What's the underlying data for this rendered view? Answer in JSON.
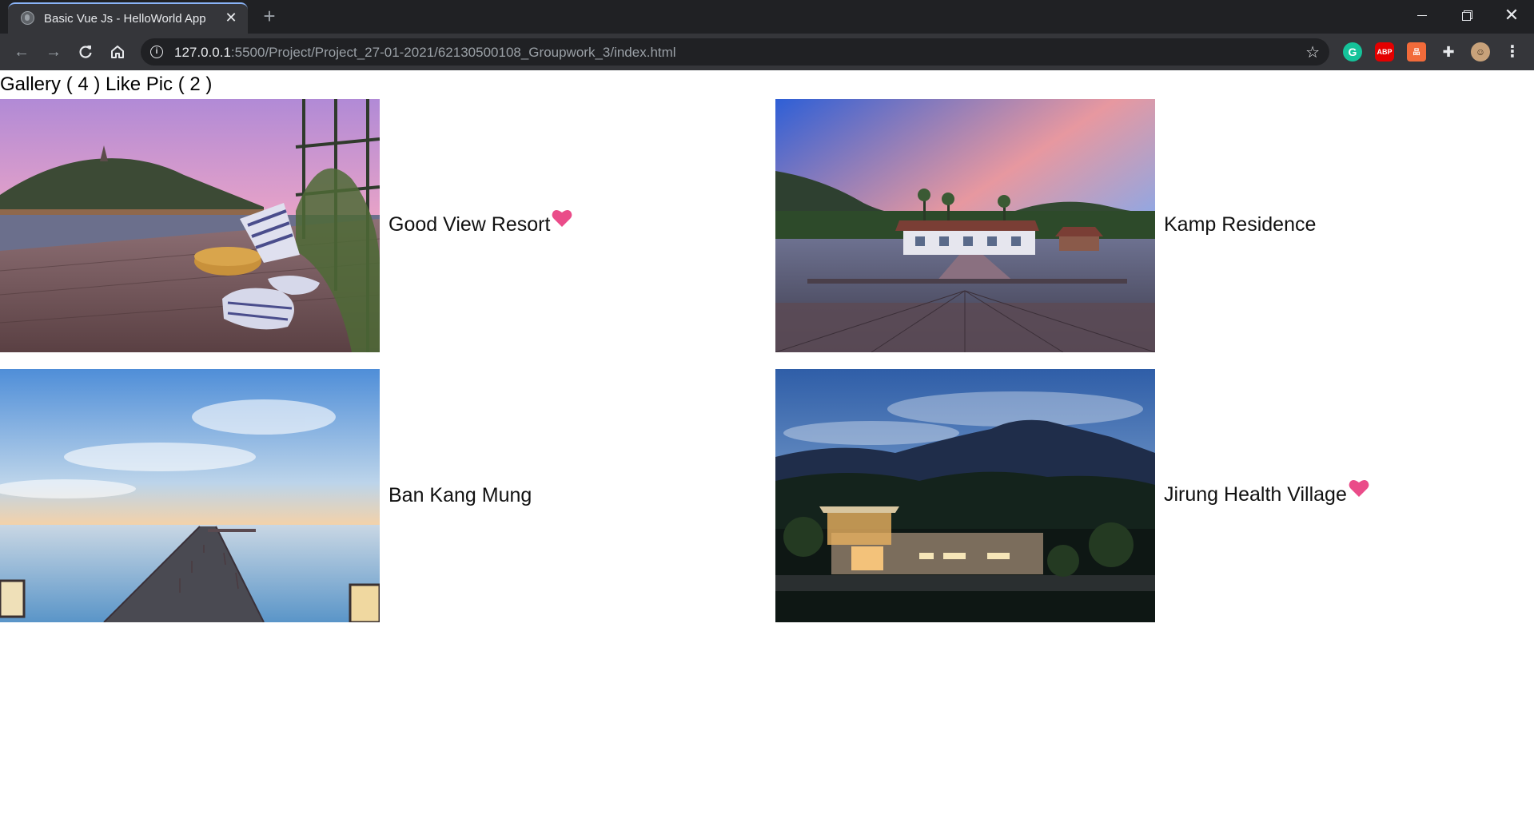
{
  "browser": {
    "tab_title": "Basic Vue Js - HelloWorld App",
    "tab_close": "✕",
    "new_tab": "+",
    "url_host": "127.0.0.1",
    "url_path": ":5500/Project/Project_27-01-2021/62130500108_Groupwork_3/index.html"
  },
  "page": {
    "gallery_label": "Gallery ( 4 ) Like Pic ( 2 )"
  },
  "gallery": [
    {
      "name": "Good View Resort",
      "liked": true
    },
    {
      "name": "Kamp Residence",
      "liked": false
    },
    {
      "name": "Ban Kang Mung",
      "liked": false
    },
    {
      "name": "Jirung Health Village",
      "liked": true
    }
  ],
  "colors": {
    "heart": "#ea4c89",
    "chrome_dark": "#202124",
    "chrome_toolbar": "#35363a"
  }
}
